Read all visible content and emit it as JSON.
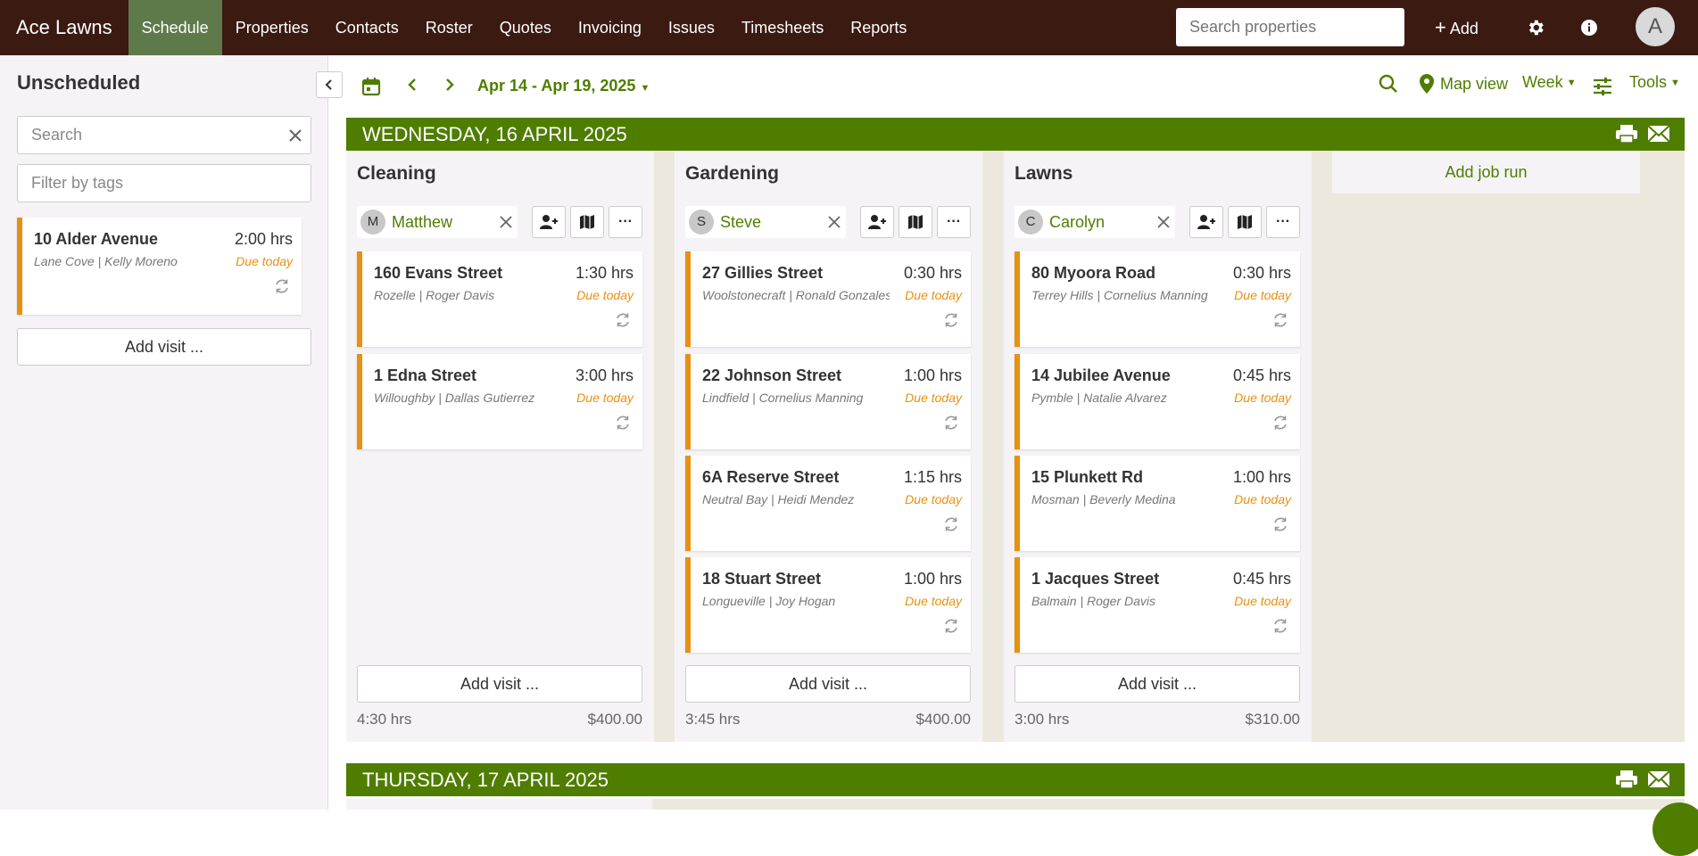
{
  "app": {
    "brand": "Ace Lawns"
  },
  "nav": {
    "items": [
      "Schedule",
      "Properties",
      "Contacts",
      "Roster",
      "Quotes",
      "Invoicing",
      "Issues",
      "Timesheets",
      "Reports"
    ],
    "active": "Schedule"
  },
  "topbar": {
    "search_placeholder": "Search properties",
    "add_label": "Add",
    "avatar_letter": "A"
  },
  "sidebar": {
    "title": "Unscheduled",
    "search_placeholder": "Search",
    "tags_placeholder": "Filter by tags",
    "card": {
      "address": "10 Alder Avenue",
      "hours": "2:00 hrs",
      "sub": "Lane Cove | Kelly Moreno",
      "due": "Due today"
    },
    "add_visit": "Add visit ..."
  },
  "toolbar": {
    "date_range": "Apr 14 - Apr 19, 2025",
    "map_view": "Map view",
    "week": "Week",
    "tools": "Tools"
  },
  "days": [
    {
      "label": "WEDNESDAY, 16 APRIL 2025"
    },
    {
      "label": "THURSDAY, 17 APRIL 2025"
    }
  ],
  "add_job_run": "Add job run",
  "columns": [
    {
      "title": "Cleaning",
      "staff": {
        "initial": "M",
        "name": "Matthew"
      },
      "visits": [
        {
          "address": "160 Evans Street",
          "hours": "1:30 hrs",
          "sub": "Rozelle | Roger Davis",
          "due": "Due today"
        },
        {
          "address": "1 Edna Street",
          "hours": "3:00 hrs",
          "sub": "Willoughby | Dallas Gutierrez",
          "due": "Due today"
        }
      ],
      "add_visit": "Add visit ...",
      "total_hours": "4:30 hrs",
      "total_amount": "$400.00"
    },
    {
      "title": "Gardening",
      "staff": {
        "initial": "S",
        "name": "Steve"
      },
      "visits": [
        {
          "address": "27 Gillies Street",
          "hours": "0:30 hrs",
          "sub": "Woolstonecraft | Ronald Gonzales",
          "due": "Due today"
        },
        {
          "address": "22 Johnson Street",
          "hours": "1:00 hrs",
          "sub": "Lindfield | Cornelius Manning",
          "due": "Due today"
        },
        {
          "address": "6A Reserve Street",
          "hours": "1:15 hrs",
          "sub": "Neutral Bay | Heidi Mendez",
          "due": "Due today"
        },
        {
          "address": "18 Stuart Street",
          "hours": "1:00 hrs",
          "sub": "Longueville | Joy Hogan",
          "due": "Due today"
        }
      ],
      "add_visit": "Add visit ...",
      "total_hours": "3:45 hrs",
      "total_amount": "$400.00"
    },
    {
      "title": "Lawns",
      "staff": {
        "initial": "C",
        "name": "Carolyn"
      },
      "visits": [
        {
          "address": "80 Myoora Road",
          "hours": "0:30 hrs",
          "sub": "Terrey Hills | Cornelius Manning",
          "due": "Due today"
        },
        {
          "address": "14 Jubilee Avenue",
          "hours": "0:45 hrs",
          "sub": "Pymble | Natalie Alvarez",
          "due": "Due today"
        },
        {
          "address": "15 Plunkett Rd",
          "hours": "1:00 hrs",
          "sub": "Mosman | Beverly Medina",
          "due": "Due today"
        },
        {
          "address": "1 Jacques Street",
          "hours": "0:45 hrs",
          "sub": "Balmain | Roger Davis",
          "due": "Due today"
        }
      ],
      "add_visit": "Add visit ...",
      "total_hours": "3:00 hrs",
      "total_amount": "$310.00"
    }
  ],
  "colors": {
    "topbar": "#3b1a12",
    "nav_active": "#5e7a4a",
    "accent_green": "#4f7d00",
    "due_orange": "#e8900f"
  }
}
